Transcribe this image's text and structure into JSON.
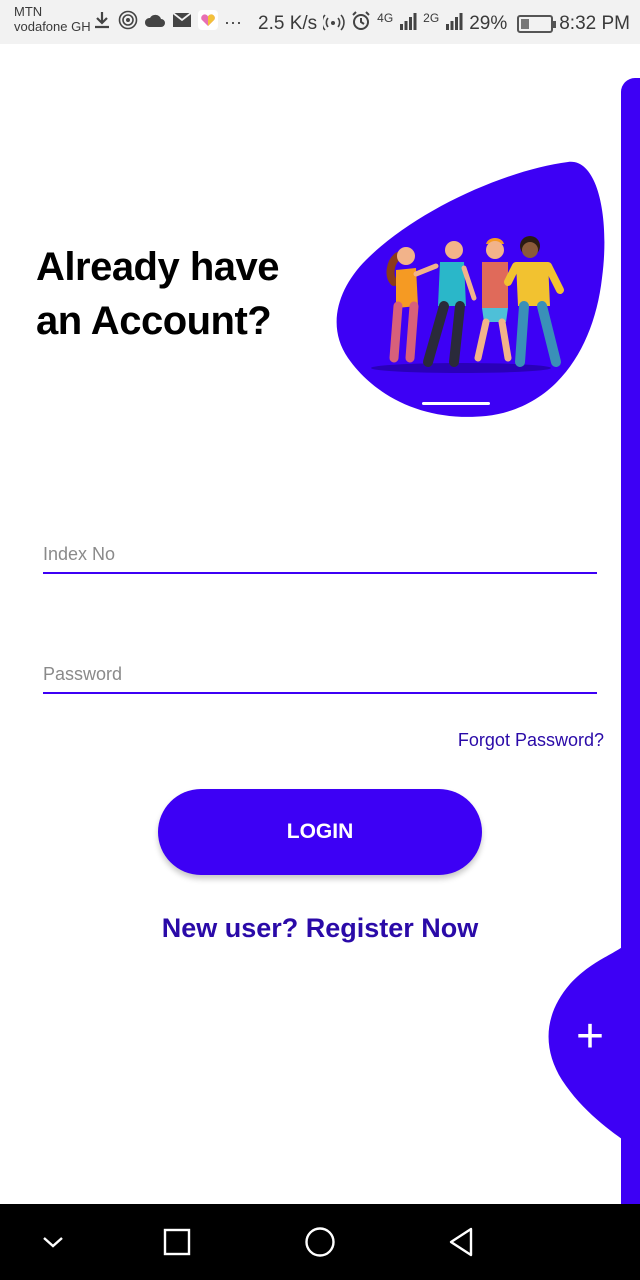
{
  "status_bar": {
    "carrier_1": "MTN",
    "carrier_2": "vodafone GH",
    "more": "···",
    "speed": "2.5 K/s",
    "net_4g": "4G",
    "net_2g": "2G",
    "battery": "29%",
    "battery_level": 0.29,
    "time": "8:32 PM",
    "icons": [
      "download-icon",
      "hotspot-icon",
      "cloud-icon",
      "mail-icon",
      "heart-app-icon",
      "wifi-icon",
      "alarm-icon",
      "signal-icon",
      "battery-icon"
    ]
  },
  "header": {
    "title_line1": "Already have",
    "title_line2": "an Account?"
  },
  "form": {
    "index_placeholder": "Index No",
    "index_value": "",
    "password_placeholder": "Password",
    "password_value": "",
    "forgot_label": "Forgot Password?",
    "login_label": "LOGIN",
    "register_label": "New user? Register Now"
  },
  "fab": {
    "icon": "plus-icon"
  },
  "nav_bar": {
    "icons": [
      "chevron-down-icon",
      "recents-icon",
      "home-icon",
      "back-icon"
    ]
  },
  "colors": {
    "accent": "#3d00f5",
    "link": "#2a0aa8",
    "status_bar_bg": "#f2f2f2",
    "nav_bar_bg": "#000000"
  }
}
